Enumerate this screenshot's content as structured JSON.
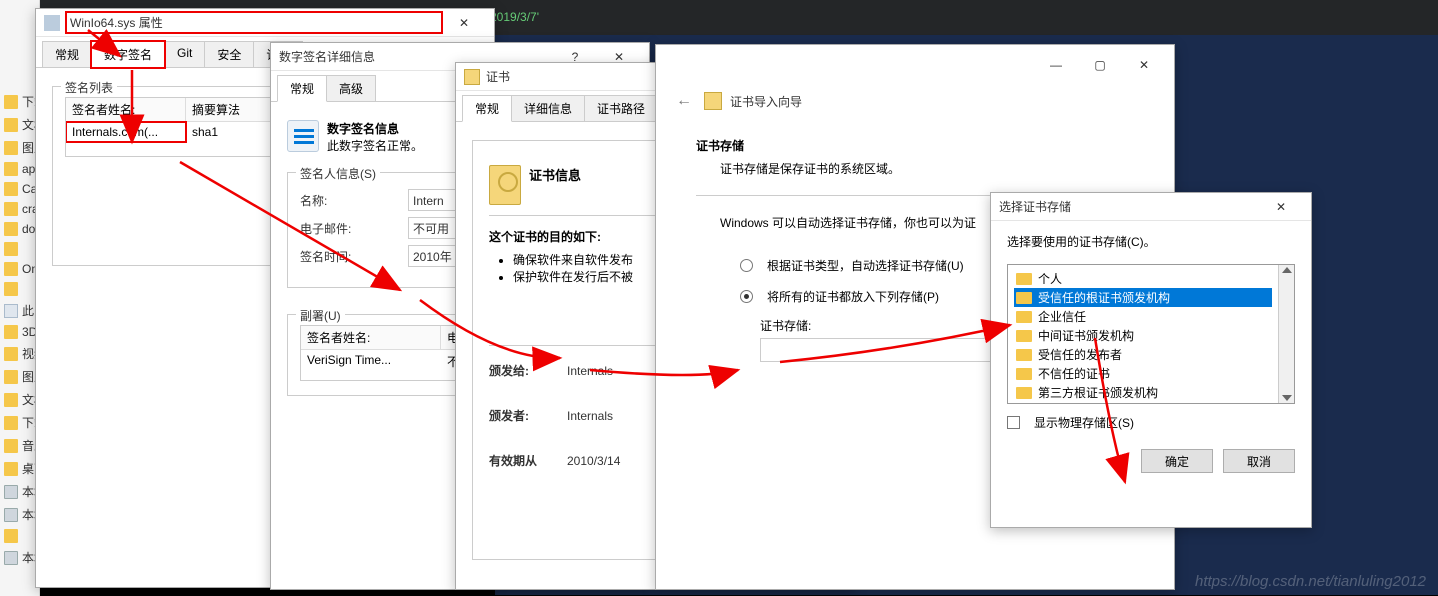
{
  "top_path": "2019/3/7'",
  "explorer_items": [
    "下载",
    "文档",
    "图片",
    "api",
    "Ca",
    "cra",
    "doc",
    "",
    "OneD",
    "",
    "此电",
    "3D",
    "视频",
    "图片",
    "文档",
    "下载",
    "音乐",
    "桌面",
    "本地",
    "本地",
    "",
    "本地"
  ],
  "win1": {
    "title": "WinIo64.sys 属性",
    "tabs": [
      "常规",
      "数字签名",
      "Git",
      "安全",
      "详组"
    ],
    "active_tab": 1,
    "group_label": "签名列表",
    "col1": "签名者姓名:",
    "col2": "摘要算法",
    "row_name": "Internals.com(...",
    "row_alg": "sha1"
  },
  "win2": {
    "title": "数字签名详细信息",
    "tabs": [
      "常规",
      "高级"
    ],
    "active_tab": 0,
    "heading": "数字签名信息",
    "status": "此数字签名正常。",
    "signer_group": "签名人信息(S)",
    "name_label": "名称:",
    "name_value": "Intern",
    "email_label": "电子邮件:",
    "email_value": "不可用",
    "time_label": "签名时间:",
    "time_value": "2010年",
    "counter_group": "副署(U)",
    "cs_col1": "签名者姓名:",
    "cs_col2": "电子邮",
    "cs_row_name": "VeriSign Time...",
    "cs_row_val": "不可用"
  },
  "win3": {
    "title": "证书",
    "tabs": [
      "常规",
      "详细信息",
      "证书路径"
    ],
    "active_tab": 0,
    "heading": "证书信息",
    "purpose_intro": "这个证书的目的如下:",
    "purposes": [
      "确保软件来自软件发布",
      "保护软件在发行后不被"
    ],
    "issued_to_label": "颁发给:",
    "issued_to_value": "Internals",
    "issued_by_label": "颁发者:",
    "issued_by_value": "Internals",
    "valid_label": "有效期从",
    "valid_value": "2010/3/14"
  },
  "win4": {
    "title": "证书导入向导",
    "heading": "证书存储",
    "desc": "证书存储是保存证书的系统区域。",
    "autotext": "Windows 可以自动选择证书存储，你也可以为证",
    "opt1": "根据证书类型，自动选择证书存储(U)",
    "opt2": "将所有的证书都放入下列存储(P)",
    "store_label": "证书存储:"
  },
  "win5": {
    "title": "选择证书存储",
    "prompt": "选择要使用的证书存储(C)。",
    "items": [
      "个人",
      "受信任的根证书颁发机构",
      "企业信任",
      "中间证书颁发机构",
      "受信任的发布者",
      "不信任的证书",
      "第三方根证书颁发机构"
    ],
    "selected_index": 1,
    "checkbox": "显示物理存储区(S)",
    "ok": "确定",
    "cancel": "取消"
  },
  "watermark": "https://blog.csdn.net/tianluling2012"
}
